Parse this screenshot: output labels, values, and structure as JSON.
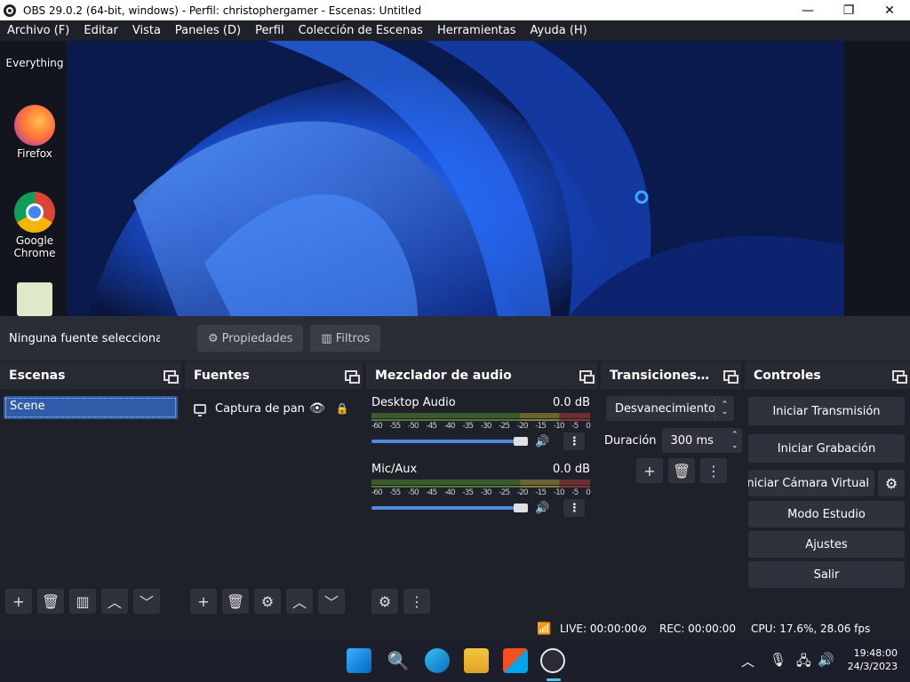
{
  "window": {
    "title": "OBS 29.0.2 (64-bit, windows) - Perfil: christophergamer - Escenas: Untitled",
    "minimize": "—",
    "maximize": "❐",
    "close": "✕"
  },
  "menu": [
    "Archivo (F)",
    "Editar",
    "Vista",
    "Paneles (D)",
    "Perfil",
    "Colección de Escenas",
    "Herramientas",
    "Ayuda (H)"
  ],
  "desktop_icons": [
    {
      "label": "Everything",
      "color": "#f5a623"
    },
    {
      "label": "Firefox",
      "color": "#ff7139"
    },
    {
      "label": "Google Chrome",
      "color": "#4285f4"
    },
    {
      "label": "",
      "color": "#7cc242"
    }
  ],
  "context": {
    "no_source": "Ninguna fuente seleccionada",
    "properties": "Propiedades",
    "filters": "Filtros"
  },
  "scenes": {
    "title": "Escenas",
    "items": [
      "Scene"
    ]
  },
  "sources": {
    "title": "Fuentes",
    "items": [
      "Captura de pantalla"
    ]
  },
  "mixer": {
    "title": "Mezclador de audio",
    "ticks": [
      "-60",
      "-55",
      "-50",
      "-45",
      "-40",
      "-35",
      "-30",
      "-25",
      "-20",
      "-15",
      "-10",
      "-5",
      "0"
    ],
    "channels": [
      {
        "name": "Desktop Audio",
        "db": "0.0 dB",
        "level": 1.0
      },
      {
        "name": "Mic/Aux",
        "db": "0.0 dB",
        "level": 1.0
      }
    ]
  },
  "transitions": {
    "title": "Transiciones de escena",
    "selected": "Desvanecimiento",
    "duration_label": "Duración",
    "duration_value": "300 ms"
  },
  "controls": {
    "title": "Controles",
    "start_stream": "Iniciar Transmisión",
    "start_record": "Iniciar Grabación",
    "start_virtualcam": "Iniciar Cámara Virtual",
    "studio_mode": "Modo Estudio",
    "settings": "Ajustes",
    "exit": "Salir"
  },
  "status": {
    "live": "LIVE: 00:00:00",
    "rec": "REC: 00:00:00",
    "cpu": "CPU: 17.6%, 28.06 fps"
  },
  "taskbar": {
    "time": "19:48:00",
    "date": "24/3/2023"
  },
  "colors": {
    "accent": "#2f5ba8",
    "panel": "#272a33",
    "background": "#1f212a",
    "wallpaper": "#1a4fd6"
  }
}
